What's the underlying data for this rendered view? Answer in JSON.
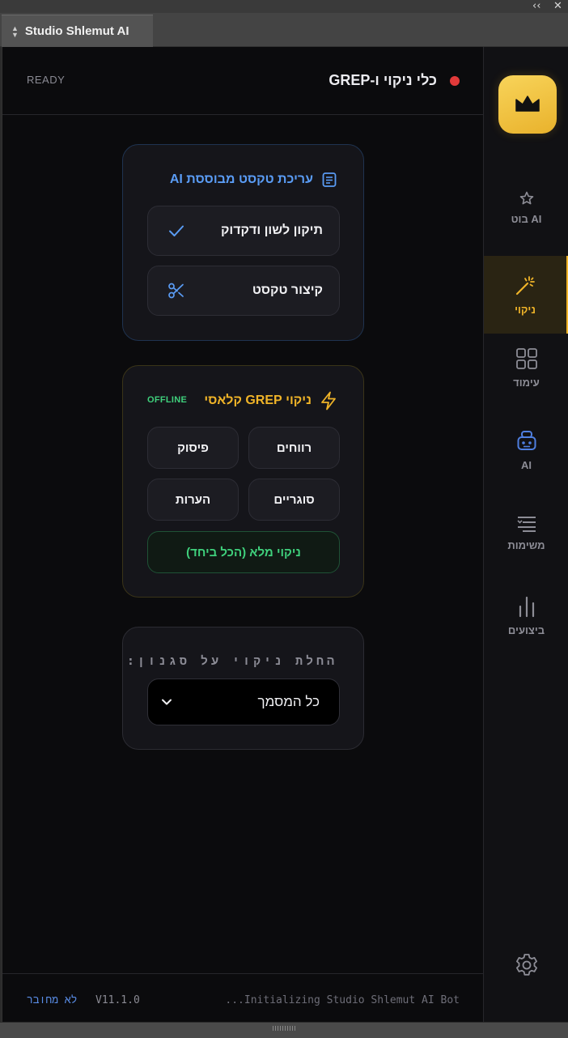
{
  "window": {
    "tab_title": "Studio Shlemut AI",
    "collapse_glyph": "‹‹",
    "close_glyph": "✕"
  },
  "header": {
    "status": "READY",
    "title": "כלי ניקוי ו-GREP",
    "status_color": "#e23a3a"
  },
  "ai_card": {
    "title": "עריכת טקסט מבוססת AI",
    "title_icon": "document-icon",
    "buttons": [
      {
        "label": "תיקון לשון ודקדוק",
        "icon": "check-icon"
      },
      {
        "label": "קיצור טקסט",
        "icon": "scissors-icon"
      }
    ],
    "accent": "#5a9cf5"
  },
  "grep_card": {
    "title": "ניקוי GREP קלאסי",
    "title_icon": "lightning-icon",
    "badge": "OFFLINE",
    "buttons": [
      "רווחים",
      "פיסוק",
      "סוגריים",
      "הערות"
    ],
    "full_clean": "ניקוי מלא (הכל ביחד)",
    "accent": "#f0b428",
    "badge_color": "#3fd07c"
  },
  "style_card": {
    "label": "החלת ניקוי על סגנון:",
    "select_value": "כל המסמך"
  },
  "footer": {
    "connection": "לא מחובר",
    "version": "V11.1.0",
    "log": "...Initializing Studio Shlemut AI Bot"
  },
  "sidebar": {
    "logo_icon": "crown-icon",
    "items": [
      {
        "label": "AI בוט",
        "icon": "star-icon",
        "active": false
      },
      {
        "label": "ניקוי",
        "icon": "magic-wand-icon",
        "active": true
      },
      {
        "label": "עימוד",
        "icon": "grid-icon",
        "active": false
      },
      {
        "label": "AI",
        "icon": "robot-icon",
        "active": false
      },
      {
        "label": "משימות",
        "icon": "list-icon",
        "active": false
      },
      {
        "label": "ביצועים",
        "icon": "bar-chart-icon",
        "active": false
      }
    ],
    "settings_icon": "gear-icon",
    "active_color": "#f0b428"
  }
}
